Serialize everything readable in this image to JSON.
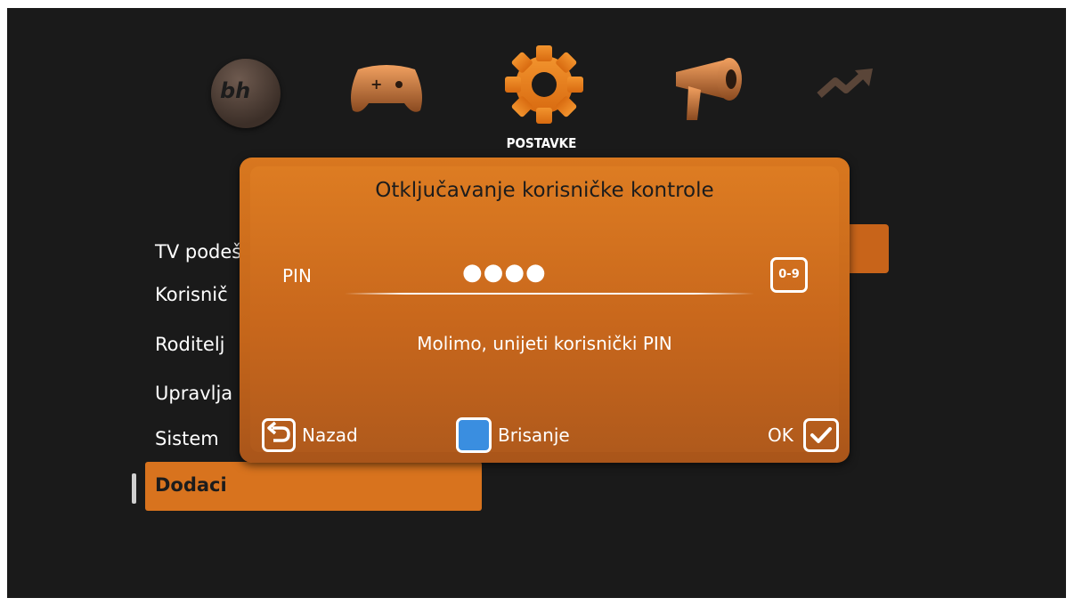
{
  "top_menu": {
    "items": [
      {
        "name": "bh-logo-icon",
        "label": "bh"
      },
      {
        "name": "gamepad-icon"
      },
      {
        "name": "gear-icon"
      },
      {
        "name": "megaphone-icon"
      },
      {
        "name": "trend-arrow-icon"
      }
    ],
    "selected_title": "POSTAVKE"
  },
  "side_menu": {
    "items": [
      {
        "label": "TV podeš"
      },
      {
        "label": "Korisnič"
      },
      {
        "label": "Roditelj"
      },
      {
        "label": "Upravlja"
      },
      {
        "label": "Sistem"
      },
      {
        "label": "Dodaci"
      }
    ]
  },
  "dialog": {
    "title": "Otključavanje korisničke kontrole",
    "pin_label": "PIN",
    "pin_value": "●●●●",
    "digits_badge": "0-9",
    "message": "Molimo, unijeti korisnički PIN",
    "back_label": "Nazad",
    "delete_label": "Brisanje",
    "ok_label": "OK"
  },
  "colors": {
    "accent": "#d8731e",
    "background": "#1a1a1a",
    "delete_key": "#3a8ee0"
  }
}
